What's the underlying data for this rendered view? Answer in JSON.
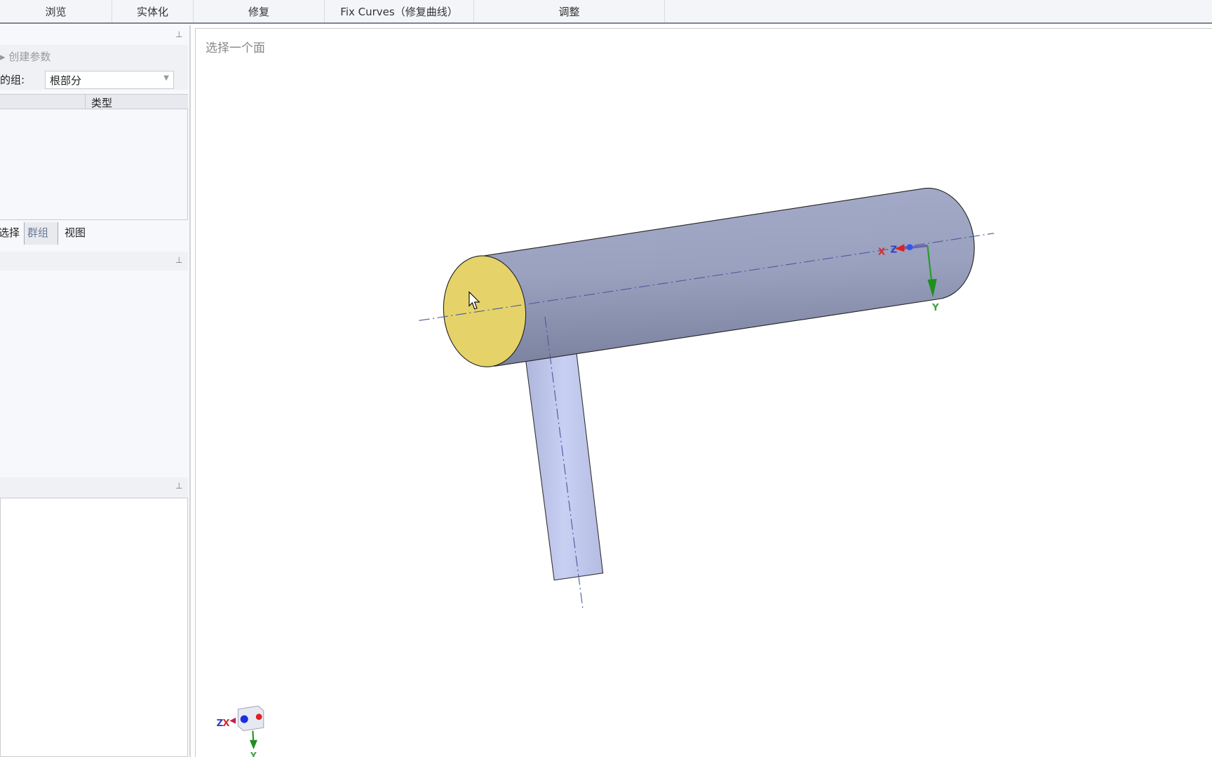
{
  "toolbar": {
    "tabs": [
      "浏览",
      "实体化",
      "修复",
      "Fix Curves（修复曲线）",
      "调整"
    ]
  },
  "left_panel": {
    "create_params": "创建参数",
    "group_label": "的组:",
    "group_value": "根部分",
    "table_header_type": "类型",
    "tabs": [
      "选择",
      "群组",
      "视图"
    ]
  },
  "viewport": {
    "hint": "选择一个面",
    "triad_labels": {
      "x": "X",
      "y": "Y",
      "z": "Z"
    }
  },
  "colors": {
    "selected_face": "#e5d36a",
    "cylinder": "#9aa1bf",
    "branch": "#c3cbf0",
    "accent_axis": "#4a5a9a"
  }
}
